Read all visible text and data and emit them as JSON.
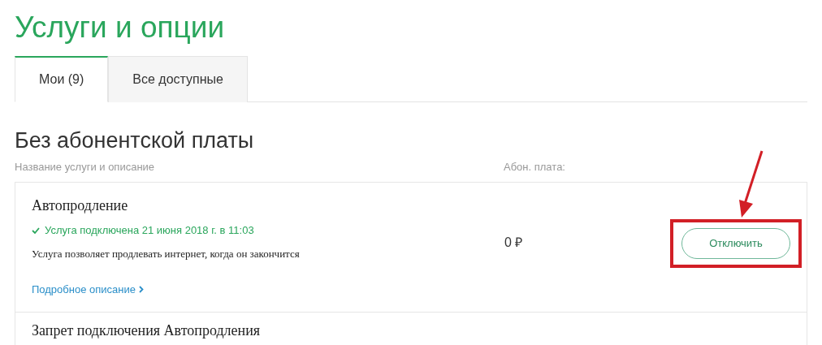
{
  "page_title": "Услуги и опции",
  "tabs": [
    {
      "label": "Мои (9)",
      "selected": true
    },
    {
      "label": "Все доступные",
      "selected": false
    }
  ],
  "section": {
    "title": "Без абонентской платы",
    "columns": [
      "Название услуги и описание",
      "Абон. плата:"
    ],
    "services": [
      {
        "name": "Автопродление",
        "status": "Услуга подключена 21 июня 2018 г. в 11:03",
        "description": "Услуга позволяет продлевать интернет, когда он закончится",
        "link": "Подробное описание",
        "price": "0 ₽",
        "action": "Отключить",
        "highlighted": true
      },
      {
        "name": "Запрет подключения Автопродления"
      }
    ]
  }
}
